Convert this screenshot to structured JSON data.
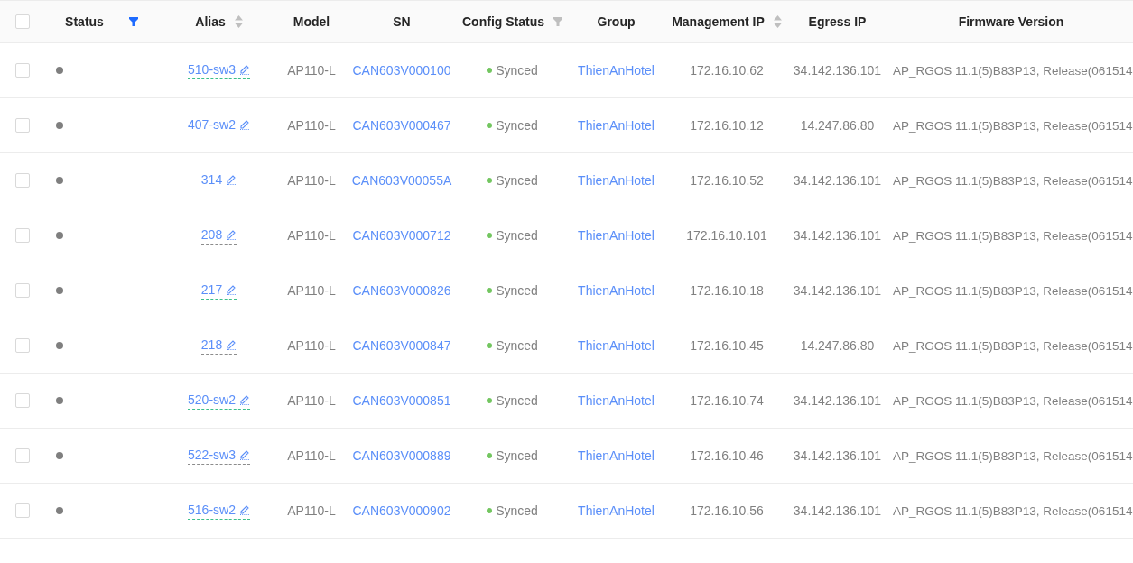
{
  "table": {
    "select_all": {
      "checked": false
    },
    "columns": [
      {
        "label": "Status",
        "kind": "filter",
        "active": true
      },
      {
        "label": "Alias",
        "kind": "sort"
      },
      {
        "label": "Model",
        "kind": "plain"
      },
      {
        "label": "SN",
        "kind": "plain"
      },
      {
        "label": "Config Status",
        "kind": "filter",
        "active": false
      },
      {
        "label": "Group",
        "kind": "plain"
      },
      {
        "label": "Management IP",
        "kind": "sort"
      },
      {
        "label": "Egress IP",
        "kind": "plain"
      },
      {
        "label": "Firmware Version",
        "kind": "plain"
      }
    ],
    "rows": [
      {
        "checked": false,
        "alias": {
          "text": "510-sw3",
          "color": "#3cc08a"
        },
        "model": "AP110-L",
        "sn": "CAN603V000100",
        "config_status": "Synced",
        "group": "ThienAnHotel",
        "management_ip": "172.16.10.62",
        "egress_ip": "34.142.136.101",
        "firmware": "AP_RGOS 11.1(5)B83P13, Release(061514"
      },
      {
        "checked": false,
        "alias": {
          "text": "407-sw2",
          "color": "#3cc08a"
        },
        "model": "AP110-L",
        "sn": "CAN603V000467",
        "config_status": "Synced",
        "group": "ThienAnHotel",
        "management_ip": "172.16.10.12",
        "egress_ip": "14.247.86.80",
        "firmware": "AP_RGOS 11.1(5)B83P13, Release(061514"
      },
      {
        "checked": false,
        "alias": {
          "text": "314",
          "color": "#8c8c8c"
        },
        "model": "AP110-L",
        "sn": "CAN603V00055A",
        "config_status": "Synced",
        "group": "ThienAnHotel",
        "management_ip": "172.16.10.52",
        "egress_ip": "34.142.136.101",
        "firmware": "AP_RGOS 11.1(5)B83P13, Release(061514"
      },
      {
        "checked": false,
        "alias": {
          "text": "208",
          "color": "#8c8c8c"
        },
        "model": "AP110-L",
        "sn": "CAN603V000712",
        "config_status": "Synced",
        "group": "ThienAnHotel",
        "management_ip": "172.16.10.101",
        "egress_ip": "34.142.136.101",
        "firmware": "AP_RGOS 11.1(5)B83P13, Release(061514"
      },
      {
        "checked": false,
        "alias": {
          "text": "217",
          "color": "#3cc08a"
        },
        "model": "AP110-L",
        "sn": "CAN603V000826",
        "config_status": "Synced",
        "group": "ThienAnHotel",
        "management_ip": "172.16.10.18",
        "egress_ip": "34.142.136.101",
        "firmware": "AP_RGOS 11.1(5)B83P13, Release(061514"
      },
      {
        "checked": false,
        "alias": {
          "text": "218",
          "color": "#8c8c8c"
        },
        "model": "AP110-L",
        "sn": "CAN603V000847",
        "config_status": "Synced",
        "group": "ThienAnHotel",
        "management_ip": "172.16.10.45",
        "egress_ip": "14.247.86.80",
        "firmware": "AP_RGOS 11.1(5)B83P13, Release(061514"
      },
      {
        "checked": false,
        "alias": {
          "text": "520-sw2",
          "color": "#3cc08a"
        },
        "model": "AP110-L",
        "sn": "CAN603V000851",
        "config_status": "Synced",
        "group": "ThienAnHotel",
        "management_ip": "172.16.10.74",
        "egress_ip": "34.142.136.101",
        "firmware": "AP_RGOS 11.1(5)B83P13, Release(061514"
      },
      {
        "checked": false,
        "alias": {
          "text": "522-sw3",
          "color": "#8c8c8c"
        },
        "model": "AP110-L",
        "sn": "CAN603V000889",
        "config_status": "Synced",
        "group": "ThienAnHotel",
        "management_ip": "172.16.10.46",
        "egress_ip": "34.142.136.101",
        "firmware": "AP_RGOS 11.1(5)B83P13, Release(061514"
      },
      {
        "checked": false,
        "alias": {
          "text": "516-sw2",
          "color": "#3cc08a"
        },
        "model": "AP110-L",
        "sn": "CAN603V000902",
        "config_status": "Synced",
        "group": "ThienAnHotel",
        "management_ip": "172.16.10.56",
        "egress_ip": "34.142.136.101",
        "firmware": "AP_RGOS 11.1(5)B83P13, Release(061514"
      }
    ]
  }
}
